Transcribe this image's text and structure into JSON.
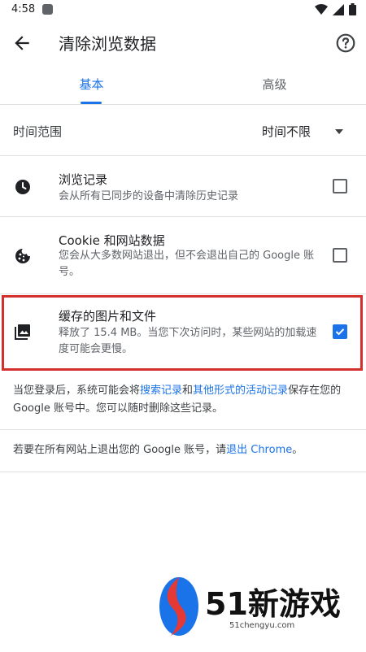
{
  "status_bar": {
    "time": "4:58"
  },
  "header": {
    "title": "清除浏览数据"
  },
  "tabs": [
    {
      "label": "基本"
    },
    {
      "label": "高级"
    }
  ],
  "time_range": {
    "label": "时间范围",
    "value": "时间不限"
  },
  "items": [
    {
      "title": "浏览记录",
      "subtitle": "会从所有已同步的设备中清除历史记录",
      "checked": false
    },
    {
      "title": "Cookie 和网站数据",
      "subtitle": "您会从大多数网站退出，但不会退出自己的 Google 账号。",
      "checked": false
    },
    {
      "title": "缓存的图片和文件",
      "subtitle": "释放了 15.4 MB。当您下次访问时，某些网站的加载速度可能会更慢。",
      "checked": true
    }
  ],
  "info": {
    "part1": "当您登录后，系统可能会将",
    "link1": "搜索记录",
    "part2": "和",
    "link2": "其他形式的活动记录",
    "part3": "保存在您的 Google 账号中。您可以随时删除这些记录。"
  },
  "signout": {
    "text": "若要在所有网站上退出您的 Google 账号，请",
    "link": "退出 Chrome",
    "end": "。"
  },
  "watermark": {
    "brand": "51新游戏",
    "url": "51chengyu.com"
  }
}
